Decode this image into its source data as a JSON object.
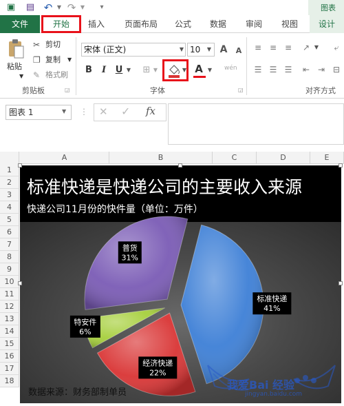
{
  "ribbon_tabs": {
    "file": "文件",
    "home": "开始",
    "insert": "插入",
    "page_layout": "页面布局",
    "formulas": "公式",
    "data": "数据",
    "review": "审阅",
    "view": "视图",
    "design": "设计"
  },
  "title_right": "图表",
  "clipboard": {
    "paste": "粘贴",
    "cut": "剪切",
    "copy": "复制",
    "format_painter": "格式刷",
    "group_label": "剪贴板"
  },
  "font": {
    "name": "宋体 (正文)",
    "size": "10",
    "bold": "B",
    "italic": "I",
    "underline": "U",
    "font_color_glyph": "A",
    "grow_glyph": "A",
    "shrink_glyph": "A",
    "group_label": "字体",
    "phonetic": "wén"
  },
  "alignment": {
    "group_label": "对齐方式"
  },
  "formula_bar": {
    "name_box": "图表 1",
    "fx": "fx",
    "cancel": "✕",
    "enter": "✓"
  },
  "columns": [
    "A",
    "B",
    "C",
    "D",
    "E"
  ],
  "rows": [
    "1",
    "2",
    "3",
    "4",
    "5",
    "6",
    "7",
    "8",
    "9",
    "10",
    "11",
    "12",
    "13",
    "14",
    "15",
    "16",
    "17",
    "18"
  ],
  "colors": {
    "excel_green": "#217346",
    "highlight_red": "#e8111a",
    "slice_blue": "#3d7fd6",
    "slice_red": "#d93434",
    "slice_green": "#a6cf3c",
    "slice_purple": "#7a5bb5"
  },
  "chart_data": {
    "type": "pie",
    "exploded": true,
    "title": "标准快递是快递公司的主要收入来源",
    "subtitle": "快递公司11月份的快件量（单位：万件）",
    "source_note": "数据来源：财务部制单员",
    "slices": [
      {
        "label": "标准快递",
        "percent_label": "41%",
        "value": 41,
        "color": "#3d7fd6"
      },
      {
        "label": "经济快递",
        "percent_label": "22%",
        "value": 22,
        "color": "#d93434"
      },
      {
        "label": "特安件",
        "percent_label": "6%",
        "value": 6,
        "color": "#a6cf3c"
      },
      {
        "label": "普货",
        "percent_label": "31%",
        "value": 31,
        "color": "#7a5bb5"
      }
    ]
  },
  "watermark": {
    "text": "我爱Bai 经验",
    "url": "jingyan.baidu.com"
  }
}
